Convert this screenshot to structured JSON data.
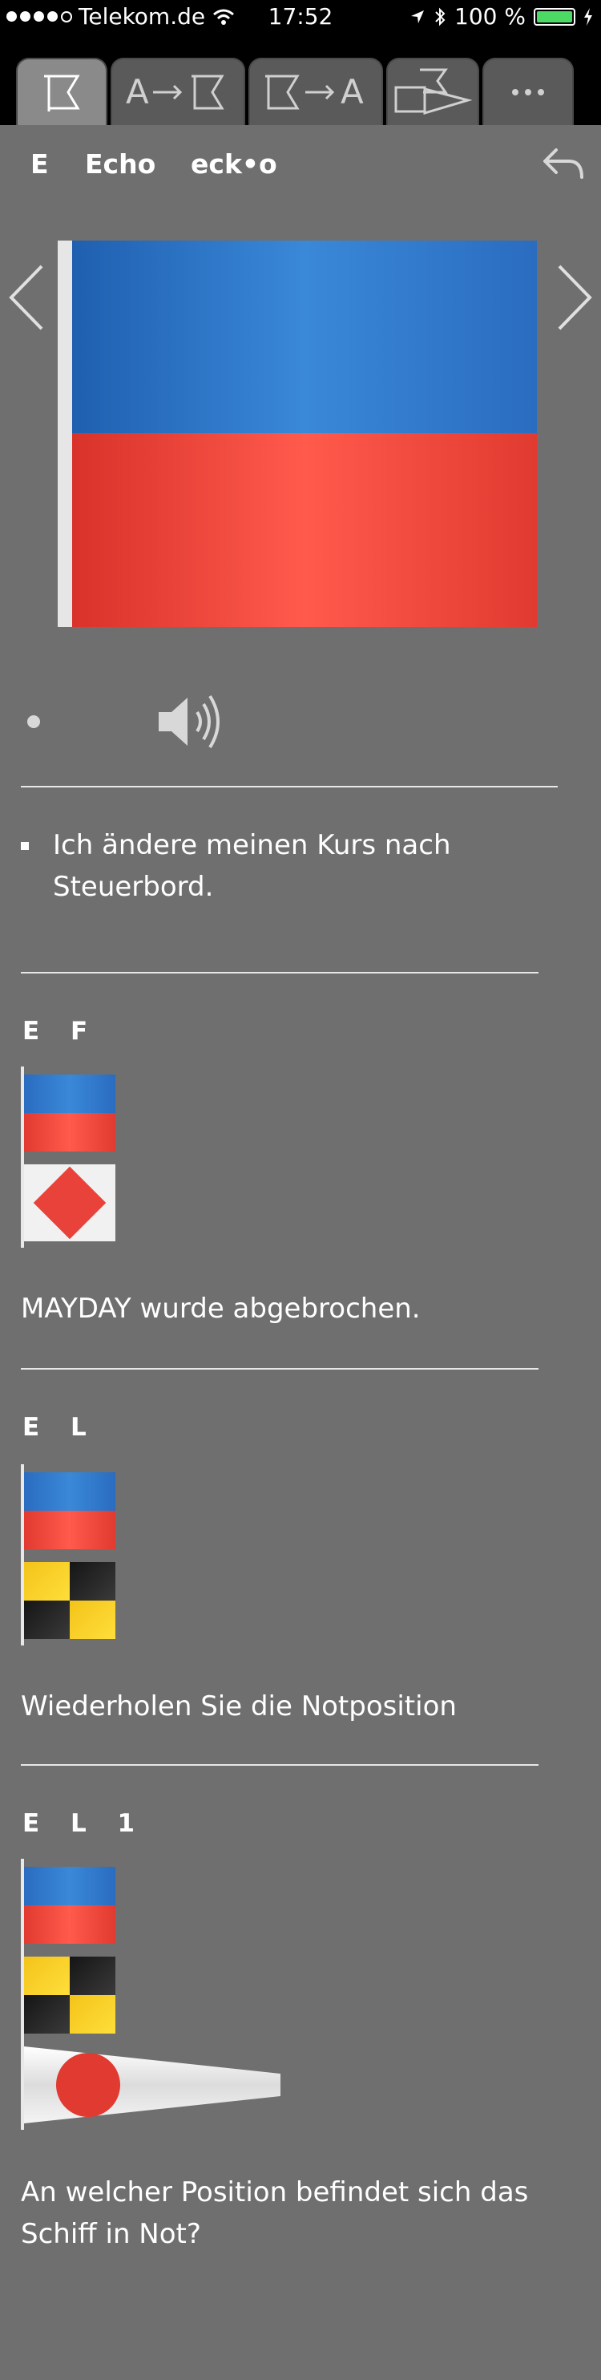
{
  "status_bar": {
    "carrier": "Telekom.de",
    "time": "17:52",
    "battery_percent": "100 %",
    "icons": [
      "signal-dots-icon",
      "wifi-icon",
      "location-arrow-icon",
      "bluetooth-icon",
      "battery-icon",
      "charging-bolt-icon"
    ]
  },
  "tabs": [
    {
      "name": "flag-tab",
      "label": "",
      "icon": "flag-icon",
      "active": true
    },
    {
      "name": "letter-to-flag-tab",
      "label": "A→",
      "icon": "flag-icon",
      "active": false
    },
    {
      "name": "flag-to-letter-tab",
      "label": "→A",
      "icon": "flag-icon",
      "active": false
    },
    {
      "name": "shapes-tab",
      "label": "",
      "icon": "shapes-icon",
      "active": false
    },
    {
      "name": "more-tab",
      "label": "···",
      "icon": "more-icon",
      "active": false
    }
  ],
  "header": {
    "letter": "E",
    "word": "Echo",
    "phonetic": "eck•o"
  },
  "main_flag": {
    "colors": [
      "#2a6cc0",
      "#e13a30"
    ]
  },
  "meaning": "Ich ändere meinen Kurs nach Steuerbord.",
  "signals": [
    {
      "title": "E F",
      "text": "MAYDAY wurde abgebrochen.",
      "flags": [
        "echo",
        "foxtrot"
      ]
    },
    {
      "title": "E L",
      "text": "Wiederholen Sie die Notposition",
      "flags": [
        "echo",
        "lima"
      ]
    },
    {
      "title": "E L 1",
      "text": "An welcher Position befindet sich das Schiff in Not?",
      "flags": [
        "echo",
        "lima",
        "pennant-1"
      ]
    }
  ],
  "colors": {
    "background": "#6f6f6f",
    "blue": "#2a6cc0",
    "red": "#e13a30",
    "yellow": "#f3c41a",
    "black": "#151515"
  }
}
